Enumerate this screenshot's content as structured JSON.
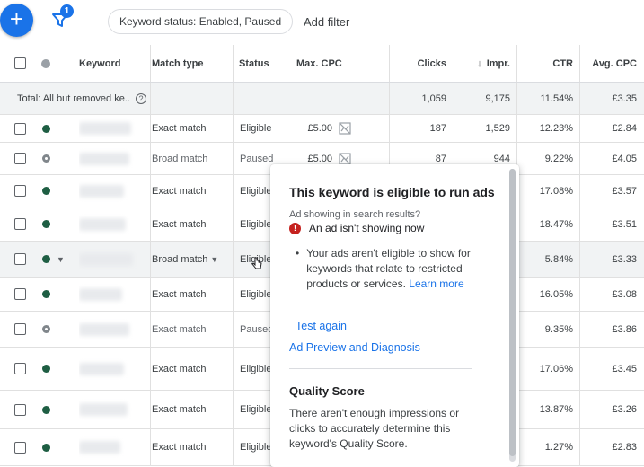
{
  "toolbar": {
    "fab_symbol": "+",
    "filter_badge": "1",
    "chip_label": "Keyword status: Enabled, Paused",
    "add_filter": "Add filter"
  },
  "columns": {
    "keyword": "Keyword",
    "match_type": "Match type",
    "status": "Status",
    "max_cpc": "Max. CPC",
    "clicks": "Clicks",
    "sort_arrow": "↓",
    "impr": "Impr.",
    "ctr": "CTR",
    "avg_cpc": "Avg. CPC"
  },
  "total": {
    "label": "Total: All but removed ke...",
    "help_icon": "?",
    "clicks": "1,059",
    "impr": "9,175",
    "ctr": "11.54%",
    "avg_cpc": "£3.35"
  },
  "rows": [
    {
      "status_color": "enabled",
      "match": "Exact match",
      "status": "Eligible",
      "max_cpc": "£5.00",
      "clicks": "187",
      "impr": "1,529",
      "ctr": "12.23%",
      "avg_cpc": "£2.84"
    },
    {
      "status_color": "paused",
      "match": "Broad match",
      "status": "Paused",
      "max_cpc": "£5.00",
      "clicks": "87",
      "impr": "944",
      "ctr": "9.22%",
      "avg_cpc": "£4.05"
    },
    {
      "status_color": "enabled",
      "match": "Exact match",
      "status": "Eligible",
      "max_cpc": "",
      "clicks": "",
      "impr": "",
      "ctr": "17.08%",
      "avg_cpc": "£3.57"
    },
    {
      "status_color": "enabled",
      "match": "Exact match",
      "status": "Eligible",
      "max_cpc": "",
      "clicks": "",
      "impr": "",
      "ctr": "18.47%",
      "avg_cpc": "£3.51"
    },
    {
      "status_color": "enabled",
      "match": "Broad match",
      "status": "Eligible",
      "max_cpc": "",
      "clicks": "",
      "impr": "",
      "ctr": "5.84%",
      "avg_cpc": "£3.33"
    },
    {
      "status_color": "enabled",
      "match": "Exact match",
      "status": "Eligible",
      "max_cpc": "",
      "clicks": "",
      "impr": "",
      "ctr": "16.05%",
      "avg_cpc": "£3.08"
    },
    {
      "status_color": "paused",
      "match": "Exact match",
      "status": "Paused",
      "max_cpc": "",
      "clicks": "",
      "impr": "",
      "ctr": "9.35%",
      "avg_cpc": "£3.86"
    },
    {
      "status_color": "enabled",
      "match": "Exact match",
      "status": "Eligible",
      "max_cpc": "",
      "clicks": "",
      "impr": "",
      "ctr": "17.06%",
      "avg_cpc": "£3.45"
    },
    {
      "status_color": "enabled",
      "match": "Exact match",
      "status": "Eligible",
      "max_cpc": "",
      "clicks": "",
      "impr": "",
      "ctr": "13.87%",
      "avg_cpc": "£3.26"
    },
    {
      "status_color": "enabled",
      "match": "Exact match",
      "status": "Eligible",
      "max_cpc": "",
      "clicks": "",
      "impr": "",
      "ctr": "1.27%",
      "avg_cpc": "£2.83"
    }
  ],
  "popover": {
    "title": "This keyword is eligible to run ads",
    "subtitle": "Ad showing in search results?",
    "alert_icon": "!",
    "alert_text": "An ad isn't showing now",
    "bullet_symbol": "•",
    "bullet_text": "Your ads aren't eligible to show for keywords that relate to restricted products or services.",
    "learn_more": "Learn more",
    "test_again": "Test again",
    "diagnosis": "Ad Preview and Diagnosis",
    "qs_title": "Quality Score",
    "qs_text": "There aren't enough impressions or clicks to accurately determine this keyword's Quality Score."
  },
  "colors": {
    "accent": "#1a73e8",
    "enabled_dot": "#1e5e43",
    "paused_dot": "#80868b",
    "alert": "#c5221f"
  }
}
